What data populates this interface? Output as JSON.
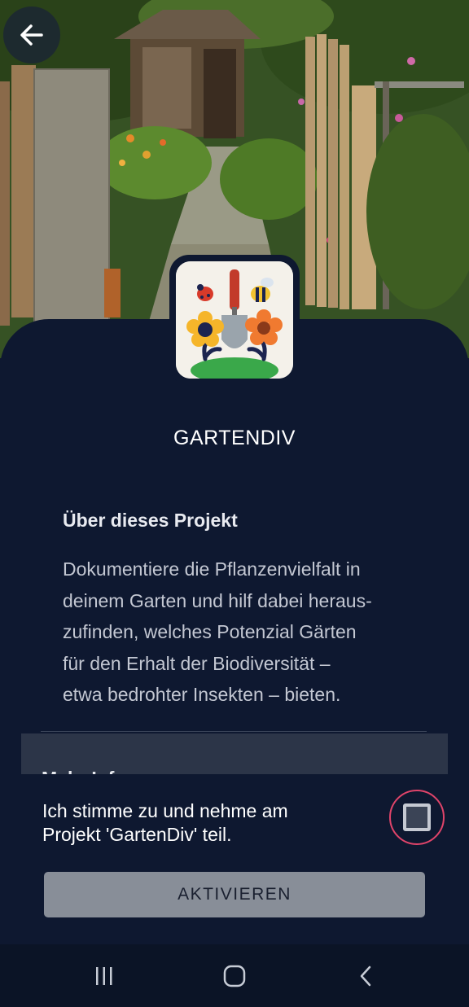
{
  "header": {
    "back_icon": "arrow-left-icon"
  },
  "project": {
    "name": "GARTENDIV",
    "logo_icon": "garden-trowel-flowers-logo"
  },
  "about": {
    "heading": "Über dieses Projekt",
    "lines": [
      "Dokumentiere die Pflanzenvielfalt in",
      "deinem Garten und hilf dabei heraus-",
      "zufinden, welches Potenzial Gärten",
      "für den Erhalt der Biodiversität –",
      "etwa bedrohter Insekten – bieten."
    ]
  },
  "more": {
    "label": "Mehr Infos"
  },
  "consent": {
    "lines": [
      "Ich stimme zu und nehme am",
      "Projekt 'GartenDiv' teil."
    ],
    "checked": false,
    "ring_color": "#e0446a"
  },
  "activate": {
    "label": "AKTIVIEREN",
    "enabled": false
  },
  "navbar": {
    "recent": "recent-apps-icon",
    "home": "home-icon",
    "back": "back-chevron-icon"
  },
  "colors": {
    "background": "#0e1830",
    "button": "#888e98"
  }
}
